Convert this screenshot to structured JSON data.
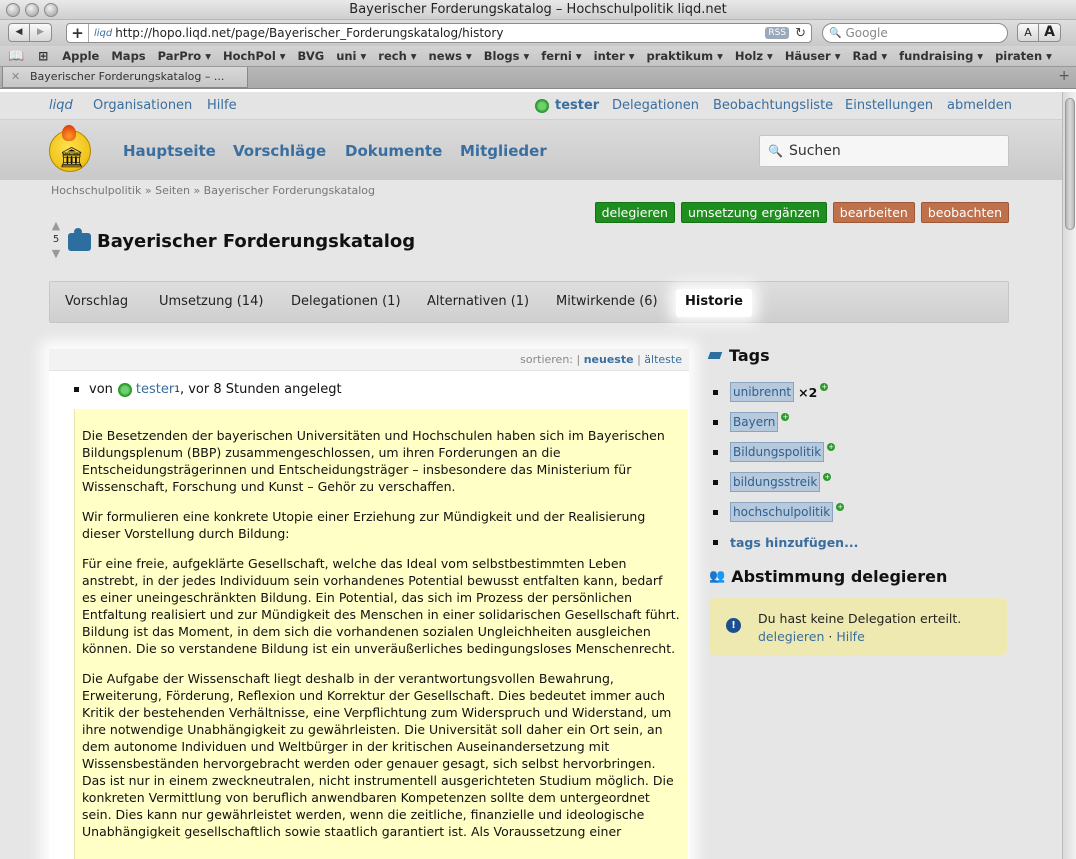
{
  "browser": {
    "window_title": "Bayerischer Forderungskatalog – Hochschulpolitik liqd.net",
    "url": "http://hopo.liqd.net/page/Bayerischer_Forderungskatalog/history",
    "favicon_text": "liqd",
    "rss_label": "RSS",
    "search_placeholder": "Google",
    "font_small": "A",
    "font_large": "A",
    "bookmarks": [
      "Apple",
      "Maps",
      "ParPro ▾",
      "HochPol ▾",
      "BVG",
      "uni ▾",
      "rech ▾",
      "news ▾",
      "Blogs ▾",
      "ferni ▾",
      "inter ▾",
      "praktikum ▾",
      "Holz ▾",
      "Häuser ▾",
      "Rad ▾",
      "fundraising ▾",
      "piraten ▾"
    ],
    "tab_title": "Bayerischer Forderungskatalog – ..."
  },
  "topnav": {
    "logo": "liqd",
    "organisationen": "Organisationen",
    "hilfe": "Hilfe",
    "user": "tester",
    "delegationen": "Delegationen",
    "beobachtungsliste": "Beobachtungsliste",
    "einstellungen": "Einstellungen",
    "abmelden": "abmelden"
  },
  "header": {
    "nav": [
      "Hauptseite",
      "Vorschläge",
      "Dokumente",
      "Mitglieder"
    ],
    "search_placeholder": "Suchen"
  },
  "breadcrumb": "Hochschulpolitik » Seiten » Bayerischer Forderungskatalog",
  "actions": {
    "delegieren": "delegieren",
    "umsetzung": "umsetzung ergänzen",
    "bearbeiten": "bearbeiten",
    "beobachten": "beobachten"
  },
  "votes": {
    "count": "5"
  },
  "page_title": "Bayerischer Forderungskatalog",
  "tabs": {
    "vorschlag": "Vorschlag",
    "umsetzung": "Umsetzung (14)",
    "delegationen": "Delegationen (1)",
    "alternativen": "Alternativen (1)",
    "mitwirkende": "Mitwirkende (6)",
    "historie": "Historie"
  },
  "sort": {
    "label": "sortieren: |",
    "newest": "neueste",
    "sep": "|",
    "oldest": "älteste"
  },
  "history_entry": {
    "prefix": "von",
    "user": "tester",
    "sup": "1",
    "suffix": ", vor 8 Stunden angelegt"
  },
  "content_paragraphs": [
    "Die Besetzenden der bayerischen Universitäten und Hochschulen haben sich im Bayerischen Bildungsplenum (BBP) zusammengeschlossen, um ihren Forderungen an die Entscheidungsträgerinnen und Entscheidungsträger – insbesondere das Ministerium für Wissenschaft, Forschung und Kunst – Gehör zu verschaffen.",
    "Wir formulieren eine konkrete Utopie einer Erziehung zur Mündigkeit und der Realisierung dieser Vorstellung durch Bildung:",
    "Für eine freie, aufgeklärte Gesellschaft, welche das Ideal vom selbstbestimmten Leben anstrebt, in der jedes Individuum sein vorhandenes Potential bewusst entfalten kann, bedarf es einer uneingeschränkten Bildung. Ein Potential, das sich im Prozess der persönlichen Entfaltung realisiert und zur Mündigkeit des Menschen in einer solidarischen Gesellschaft führt. Bildung ist das Moment, in dem sich die vorhandenen sozialen Ungleichheiten ausgleichen können. Die so verstandene Bildung ist ein unveräußerliches bedingungsloses Menschenrecht.",
    "Die Aufgabe der Wissenschaft liegt deshalb in der verantwortungsvollen Bewahrung, Erweiterung, Förderung, Reflexion und Korrektur der Gesellschaft. Dies bedeutet immer auch Kritik der bestehenden Verhältnisse, eine Verpflichtung zum Widerspruch und Widerstand, um ihre notwendige Unabhängigkeit zu gewährleisten. Die Universität soll daher ein Ort sein, an dem autonome Individuen und Weltbürger in der kritischen Auseinandersetzung mit Wissensbeständen hervorgebracht werden oder genauer gesagt, sich selbst hervorbringen. Das ist nur in einem zweckneutralen, nicht instrumentell ausgerichteten Studium möglich. Die konkreten Vermittlung von beruflich anwendbaren Kompetenzen sollte dem untergeordnet sein. Dies kann nur gewährleistet werden, wenn die zeitliche, finanzielle und ideologische Unabhängigkeit gesellschaftlich sowie staatlich garantiert ist. Als Voraussetzung einer"
  ],
  "sidebar": {
    "tags_title": "Tags",
    "tags": [
      {
        "name": "unibrennt",
        "count": "×2"
      },
      {
        "name": "Bayern",
        "count": ""
      },
      {
        "name": "Bildungspolitik",
        "count": ""
      },
      {
        "name": "bildungsstreik",
        "count": ""
      },
      {
        "name": "hochschulpolitik",
        "count": ""
      }
    ],
    "add_tags": "tags hinzufügen...",
    "deleg_title": "Abstimmung delegieren",
    "notice_text": "Du hast keine Delegation erteilt.",
    "notice_link1": "delegieren",
    "notice_sep": "·",
    "notice_link2": "Hilfe"
  },
  "colors": {
    "link": "#3a6e9e",
    "green_button": "#1e8f1e",
    "brown_button": "#c0704a",
    "content_bg": "#ffffc6",
    "tag_bg": "#b6c9dd",
    "notice_bg": "#eee9b0"
  },
  "icons": {
    "back": "◀",
    "forward": "▶",
    "add": "+",
    "reload": "↻",
    "magnifier": "🔍",
    "book": "📖",
    "grid": "⊞",
    "close": "✕",
    "newtab": "+",
    "vote_up": "▲",
    "vote_down": "▼",
    "plus": "+",
    "exclamation": "!",
    "people": "👥"
  }
}
